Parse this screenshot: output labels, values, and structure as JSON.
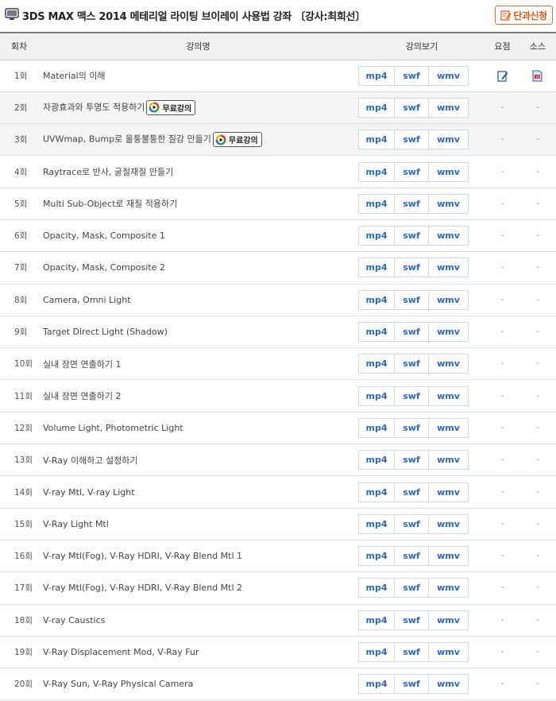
{
  "header": {
    "title": "3DS MAX 맥스 2014 메테리얼 라이팅 브이레이 사용법 강좌 〔강사:최희선〕",
    "apply_label": "단과신청"
  },
  "columns": {
    "num": "회차",
    "name": "강의명",
    "view": "강의보기",
    "summary": "요점",
    "source": "소스"
  },
  "formats": [
    "mp4",
    "swf",
    "wmv"
  ],
  "free_label": "무료강의",
  "dash": "-",
  "rows": [
    {
      "num": "1회",
      "name": "Material의 이해",
      "free": false,
      "icons": true
    },
    {
      "num": "2회",
      "name": "자광효과와 투명도 적용하기",
      "free": true,
      "icons": false
    },
    {
      "num": "3회",
      "name": "UVWmap, Bump로 울퉁불퉁한 질감 만들기",
      "free": true,
      "icons": false
    },
    {
      "num": "4회",
      "name": "Raytrace로 반사, 굴절재질 만들기",
      "free": false,
      "icons": false
    },
    {
      "num": "5회",
      "name": "Multi Sub-Object로 재질 적용하기",
      "free": false,
      "icons": false
    },
    {
      "num": "6회",
      "name": "Opacity, Mask, Composite 1",
      "free": false,
      "icons": false
    },
    {
      "num": "7회",
      "name": "Opacity, Mask, Composite 2",
      "free": false,
      "icons": false
    },
    {
      "num": "8회",
      "name": "Camera, Omni Light",
      "free": false,
      "icons": false
    },
    {
      "num": "9회",
      "name": "Target Direct Light (Shadow)",
      "free": false,
      "icons": false
    },
    {
      "num": "10회",
      "name": "실내 장면 연출하기 1",
      "free": false,
      "icons": false
    },
    {
      "num": "11회",
      "name": "실내 장면 연출하기 2",
      "free": false,
      "icons": false
    },
    {
      "num": "12회",
      "name": "Volume Light, Photometric Light",
      "free": false,
      "icons": false
    },
    {
      "num": "13회",
      "name": "V-Ray 이해하고 설정하기",
      "free": false,
      "icons": false
    },
    {
      "num": "14회",
      "name": "V-ray Mtl, V-ray Light",
      "free": false,
      "icons": false
    },
    {
      "num": "15회",
      "name": "V-Ray Light Mtl",
      "free": false,
      "icons": false
    },
    {
      "num": "16회",
      "name": "V-ray Mtl(Fog), V-Ray HDRI, V-Ray Blend Mtl 1",
      "free": false,
      "icons": false
    },
    {
      "num": "17회",
      "name": "V-ray Mtl(Fog), V-Ray HDRI, V-Ray Blend Mtl 2",
      "free": false,
      "icons": false
    },
    {
      "num": "18회",
      "name": "V-ray Caustics",
      "free": false,
      "icons": false
    },
    {
      "num": "19회",
      "name": "V-Ray Displacement Mod, V-Ray Fur",
      "free": false,
      "icons": false
    },
    {
      "num": "20회",
      "name": "V-Ray Sun, V-Ray Physical Camera",
      "free": false,
      "icons": false
    }
  ]
}
